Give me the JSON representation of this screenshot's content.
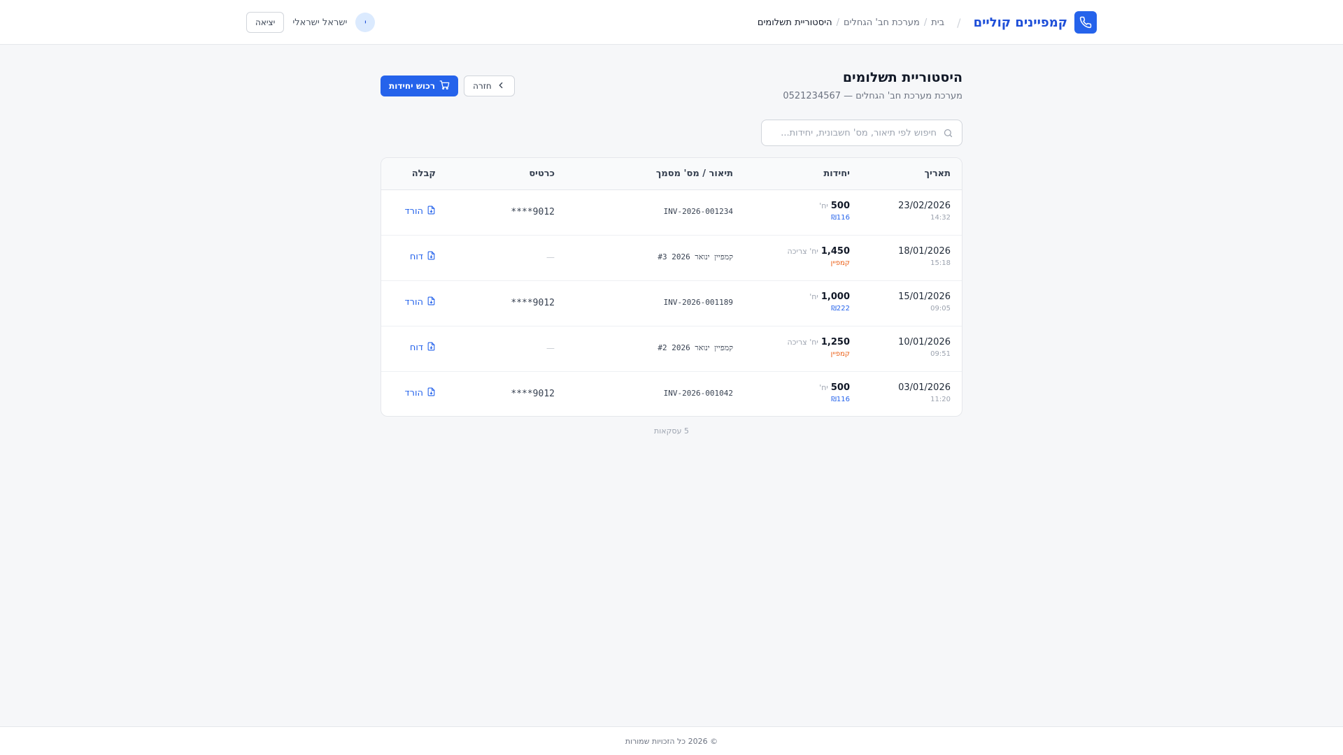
{
  "header": {
    "brand_name": "קמפיינים קוליים",
    "breadcrumbs": [
      "בית",
      "מערכת חב' הגחלים",
      "היסטוריית תשלומים"
    ],
    "user_initial": "י",
    "user_name": "ישראל ישראלי",
    "logout_label": "יציאה"
  },
  "page": {
    "title": "היסטוריית תשלומים",
    "subtitle": "מערכת מערכת חב' הגחלים — 0521234567",
    "buy_label": "רכוש יחידות",
    "back_label": "חזרה"
  },
  "search": {
    "placeholder": "חיפוש לפי תיאור, מס' חשבונית, יחידות...",
    "value": ""
  },
  "table": {
    "headers": {
      "date": "תאריך",
      "units": "יחידות",
      "description": "תיאור / מס' מסמך",
      "card": "כרטיס",
      "receipt": "קבלה"
    },
    "rows": [
      {
        "date": "23/02/2026",
        "time": "14:32",
        "units": "500",
        "units_suffix": "יח'",
        "sub_type": "price",
        "sub": "₪116",
        "description": "INV-2026-001234",
        "card": "****9012",
        "action": "הורד"
      },
      {
        "date": "18/01/2026",
        "time": "15:18",
        "units": "1,450",
        "units_suffix": "יח' צריכה",
        "sub_type": "campaign",
        "sub": "קמפיין",
        "description": "קמפיין ינואר 2026 #3",
        "card": "—",
        "action": "דוח"
      },
      {
        "date": "15/01/2026",
        "time": "09:05",
        "units": "1,000",
        "units_suffix": "יח'",
        "sub_type": "price",
        "sub": "₪222",
        "description": "INV-2026-001189",
        "card": "****9012",
        "action": "הורד"
      },
      {
        "date": "10/01/2026",
        "time": "09:51",
        "units": "1,250",
        "units_suffix": "יח' צריכה",
        "sub_type": "campaign",
        "sub": "קמפיין",
        "description": "קמפיין ינואר 2026 #2",
        "card": "—",
        "action": "דוח"
      },
      {
        "date": "03/01/2026",
        "time": "11:20",
        "units": "500",
        "units_suffix": "יח'",
        "sub_type": "price",
        "sub": "₪116",
        "description": "INV-2026-001042",
        "card": "****9012",
        "action": "הורד"
      }
    ]
  },
  "transaction_count": "5 עסקאות",
  "footer": {
    "text": "© 2026 כל הזכויות שמורות"
  },
  "colors": {
    "primary": "#2563eb",
    "campaign": "#ea580c",
    "background": "#f6f7f9"
  }
}
